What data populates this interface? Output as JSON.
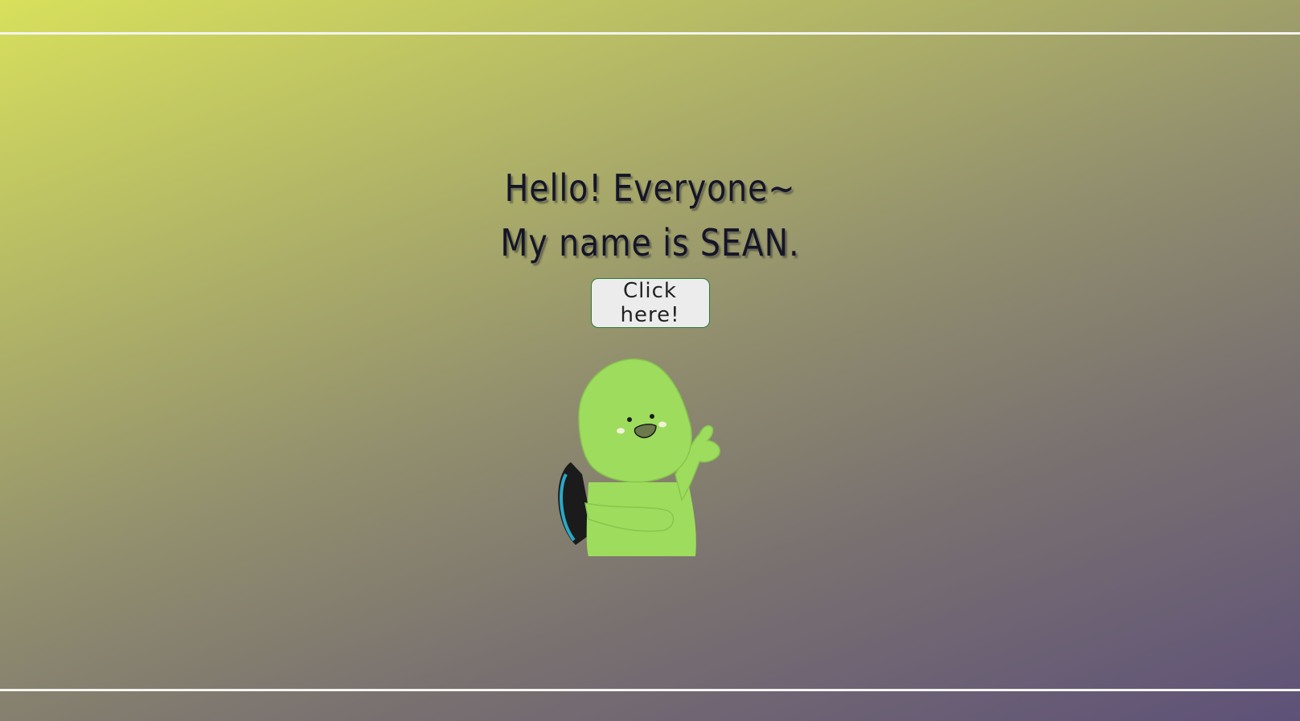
{
  "hero": {
    "line1": "Hello! Everyone~",
    "line2": "My name is SEAN.",
    "button_label": "Click here!"
  },
  "mascot": {
    "icon": "green-turtle-waving-illustration"
  },
  "colors": {
    "gradient_start": "#d8e05c",
    "gradient_end": "#5e5178",
    "rule": "#f4f4f0",
    "heading": "#151528",
    "button_bg": "#ececec",
    "button_border": "#2f7a3a",
    "mascot_green": "#9edc5e"
  }
}
